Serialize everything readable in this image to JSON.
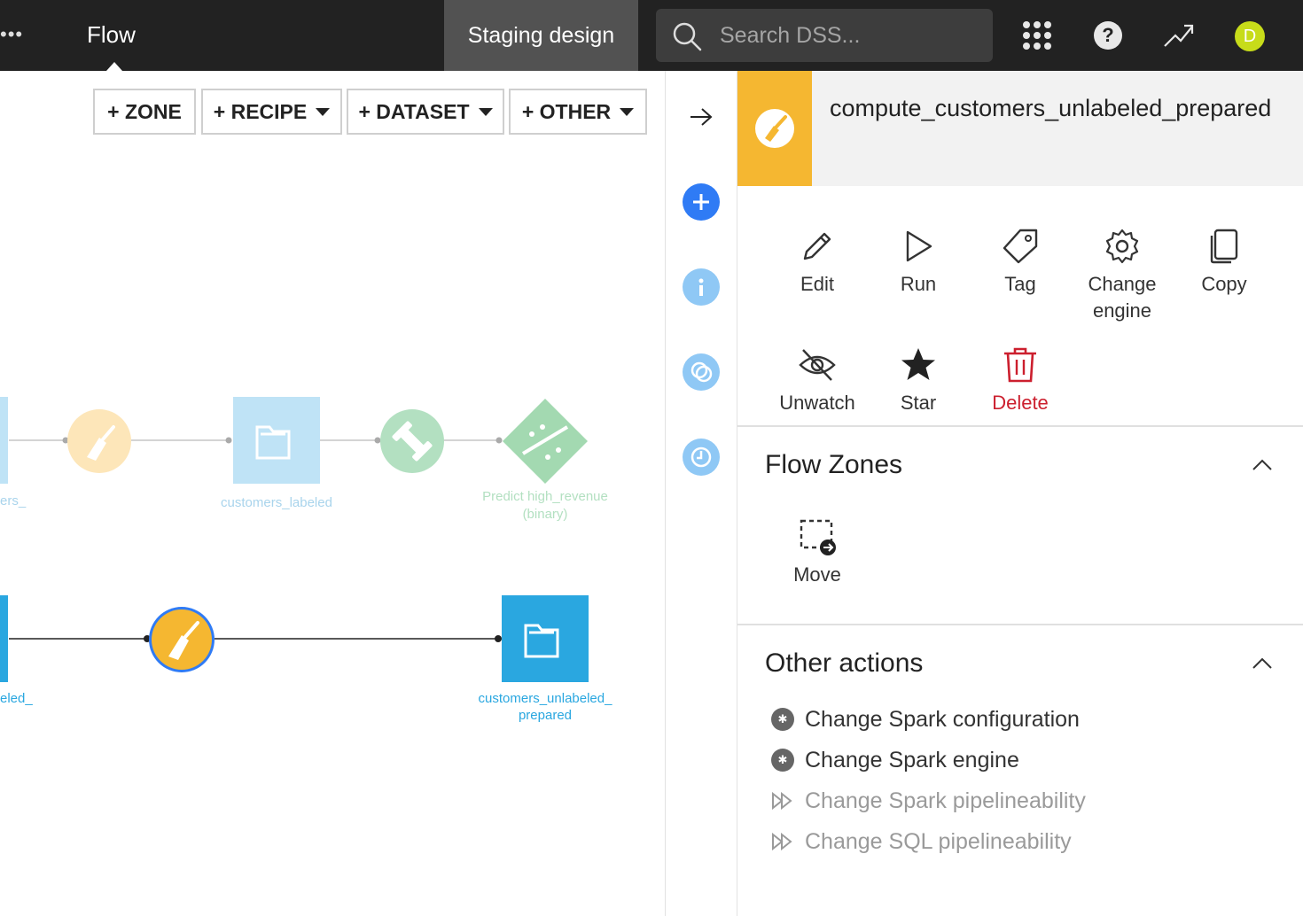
{
  "topbar": {
    "menu_dots": "•••",
    "flow_label": "Flow",
    "project_name": "Staging design",
    "search_placeholder": "Search DSS...",
    "avatar_initial": "D",
    "help_glyph": "?"
  },
  "toolbar": {
    "zone_label": "+ ZONE",
    "recipe_label": "+ RECIPE",
    "dataset_label": "+ DATASET",
    "other_label": "+ OTHER"
  },
  "flow_nodes": {
    "left_faded_label": "ers_",
    "customers_labeled": "customers_labeled",
    "predict_line1": "Predict high_revenue",
    "predict_line2": "(binary)",
    "left_active_label": "eled_",
    "unlabeled_prepared_line1": "customers_unlabeled_",
    "unlabeled_prepared_line2": "prepared"
  },
  "rail": {
    "items": [
      "collapse-arrow",
      "add",
      "info",
      "discussions",
      "history"
    ]
  },
  "panel": {
    "title": "compute_customers_unlabeled_prepared",
    "actions": [
      {
        "label": "Edit",
        "icon": "pencil-icon"
      },
      {
        "label": "Run",
        "icon": "play-icon"
      },
      {
        "label": "Tag",
        "icon": "tag-icon"
      },
      {
        "label": "Change engine",
        "icon": "gear-icon"
      },
      {
        "label": "Copy",
        "icon": "copy-icon"
      },
      {
        "label": "Unwatch",
        "icon": "eye-off-icon"
      },
      {
        "label": "Star",
        "icon": "star-icon"
      },
      {
        "label": "Delete",
        "icon": "trash-icon"
      }
    ],
    "flow_zones": {
      "title": "Flow Zones",
      "move_label": "Move"
    },
    "other_actions": {
      "title": "Other actions",
      "items": [
        {
          "label": "Change Spark configuration",
          "enabled": true
        },
        {
          "label": "Change Spark engine",
          "enabled": true
        },
        {
          "label": "Change Spark pipelineability",
          "enabled": false
        },
        {
          "label": "Change SQL pipelineability",
          "enabled": false
        }
      ]
    }
  },
  "colors": {
    "topbar_bg": "#222222",
    "staging_bg": "#525252",
    "recipe_orange": "#f5b731",
    "dataset_blue": "#2aa7e0",
    "rail_blue": "#2f7bf5",
    "rail_light_blue": "#8fc8f5",
    "delete_red": "#cc1f2e",
    "model_green": "#a3d9b1"
  }
}
